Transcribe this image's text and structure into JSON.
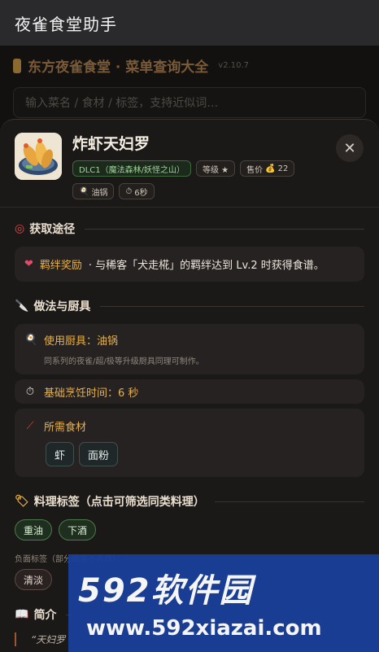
{
  "app": {
    "title": "夜雀食堂助手"
  },
  "background": {
    "site_title": "东方夜雀食堂 · 菜单查询大全",
    "version": "v2.10.7",
    "search_placeholder": "输入菜名 / 食材 / 标签，支持近似词…"
  },
  "dish": {
    "name": "炸虾天妇罗",
    "dlc": "DLC1（魔法森林/妖怪之山）",
    "level_label": "等级 ★",
    "price_label": "售价",
    "price": "22",
    "cooker_chip": "油锅",
    "time_chip": "6秒"
  },
  "obtain": {
    "title": "获取途径",
    "type": "羁绊奖励",
    "description": "· 与稀客「犬走椛」的羁绊达到 Lv.2 时获得食谱。"
  },
  "method": {
    "title": "做法与厨具",
    "cooker_line": "使用厨具：油锅",
    "cooker_note": "同系列的夜雀/超/极等升级厨具同理可制作。",
    "time_line": "基础烹饪时间：6 秒",
    "ingredients_title": "所需食材",
    "ingredients": [
      "虾",
      "面粉"
    ]
  },
  "tags": {
    "title": "料理标签（点击可筛选同类料理）",
    "positive": [
      "重油",
      "下酒"
    ],
    "negative_label": "负面标签（部分顾客不喜欢）：",
    "negative": [
      "清淡"
    ]
  },
  "intro": {
    "title": "简介",
    "quote_start": "“天妇罗"
  },
  "watermark": {
    "brand": "592软件园",
    "url": "www.592xiazai.com"
  }
}
